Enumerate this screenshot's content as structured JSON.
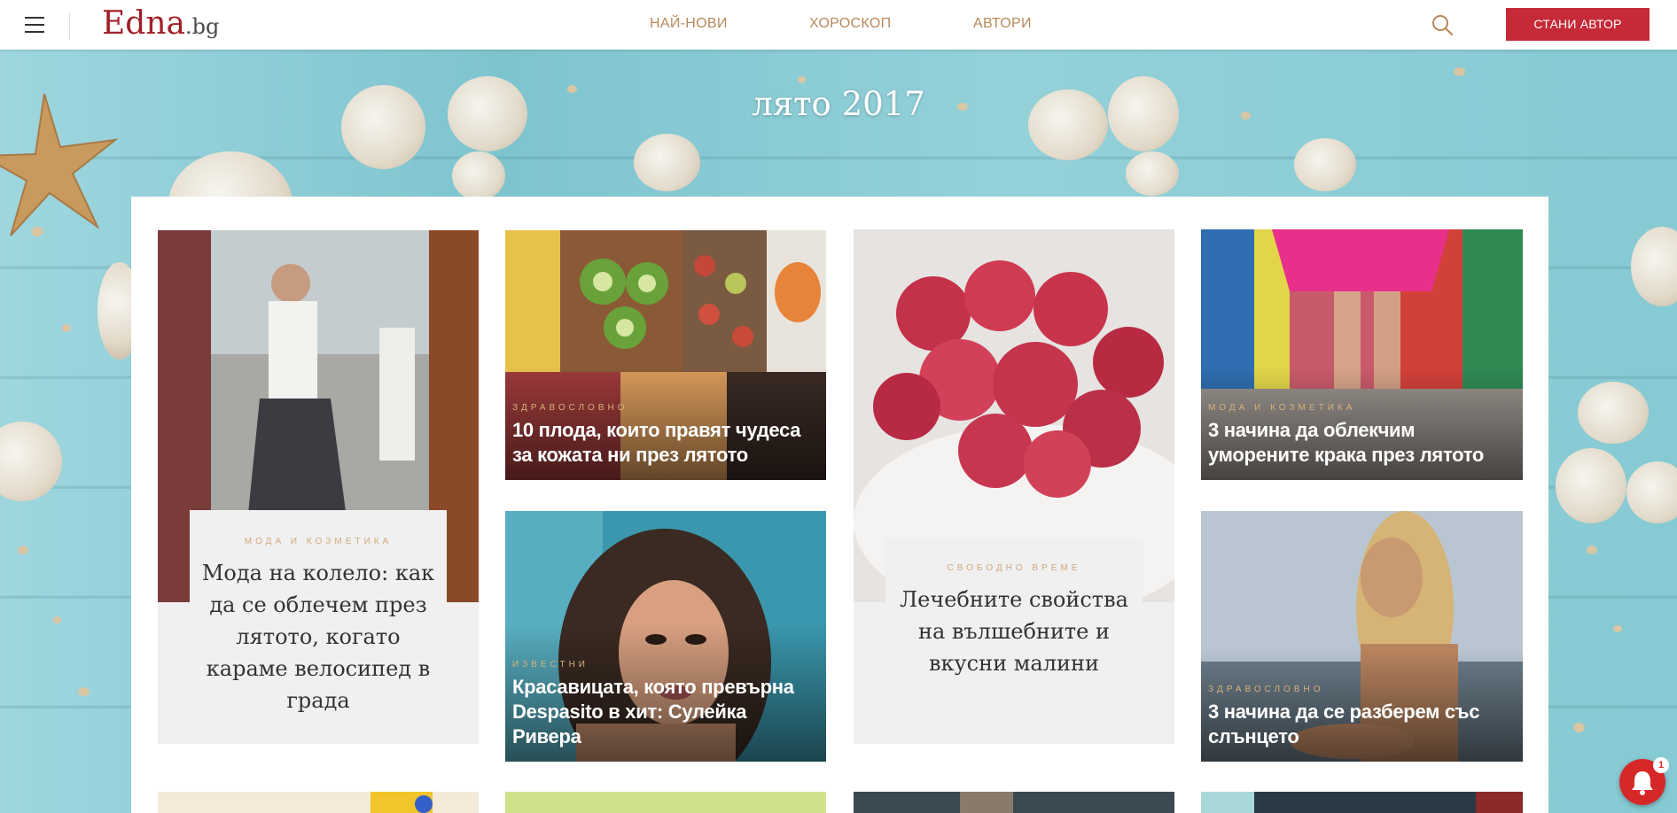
{
  "header": {
    "logo_main": "Edna",
    "logo_tld": ".bg",
    "nav": [
      "НАЙ-НОВИ",
      "ХОРОСКОП",
      "АВТОРИ"
    ],
    "cta_label": "СТАНИ АВТОР"
  },
  "page": {
    "title": "лято 2017"
  },
  "cards": [
    {
      "category": "МОДА И КОЗМЕТИКА",
      "title": "Мода на колело: как да се облечем през лятото, когато караме велосипед в града"
    },
    {
      "category": "ЗДРАВОСЛОВНО",
      "title": "10 плода, които правят чудеса за кожата ни през лятото"
    },
    {
      "category": "СВОБОДНО ВРЕМЕ",
      "title": "Лечебните свойства на вълшебните и вкусни малини"
    },
    {
      "category": "МОДА И КОЗМЕТИКА",
      "title": "3 начина да облекчим уморените крака през лятото"
    },
    {
      "category": "ИЗВЕСТНИ",
      "title": "Красавицата, която превърна Despasito в хит: Сулейка Ривера"
    },
    {
      "category": "ЗДРАВОСЛОВНО",
      "title": "3 начина да се разберем със слънцето"
    }
  ],
  "notifications": {
    "count": "1"
  },
  "colors": {
    "brand": "#a21f27",
    "cta": "#c62937",
    "nav": "#b8895a",
    "category": "#d8b07a"
  }
}
